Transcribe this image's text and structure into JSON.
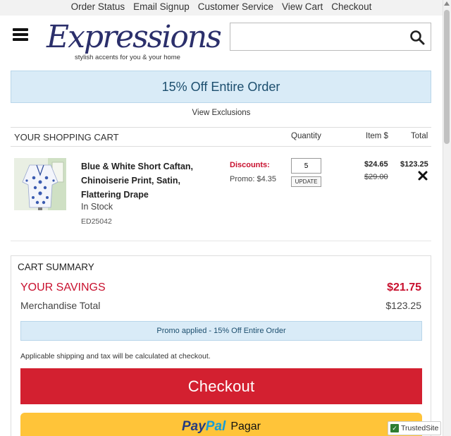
{
  "topnav": {
    "items": [
      "Order Status",
      "Email Signup",
      "Customer Service",
      "View Cart",
      "Checkout"
    ]
  },
  "header": {
    "logo_text": "Expressions",
    "logo_tagline": "stylish accents for you & your home",
    "search_placeholder": ""
  },
  "promo": {
    "banner": "15% Off Entire Order",
    "view_exclusions": "View Exclusions"
  },
  "cart": {
    "title": "YOUR SHOPPING CART",
    "col_quantity": "Quantity",
    "col_item_price": "Item $",
    "col_total": "Total",
    "items": [
      {
        "name": "Blue & White Short Caftan, Chinoiserie Print, Satin, Flattering Drape",
        "stock": "In Stock",
        "sku": "ED25042",
        "discounts_label": "Discounts:",
        "discount_promo": "Promo: $4.35",
        "quantity": "5",
        "update_label": "UPDATE",
        "price": "$24.65",
        "original_price": "$29.00",
        "line_total": "$123.25"
      }
    ]
  },
  "summary": {
    "title": "CART SUMMARY",
    "savings_label": "YOUR SAVINGS",
    "savings_value": "$21.75",
    "merch_label": "Merchandise Total",
    "merch_value": "$123.25",
    "promo_applied": "Promo applied - 15% Off Entire Order",
    "shipping_note": "Applicable shipping and tax will be calculated at checkout.",
    "checkout_label": "Checkout",
    "paypal_pay": "Pay",
    "paypal_pal": "Pal",
    "paypal_pagar": "Pagar"
  },
  "trusted": {
    "label": "TrustedSite"
  },
  "colors": {
    "accent_red": "#d32030",
    "promo_blue": "#d9ebf7",
    "paypal_yellow": "#ffc439",
    "logo_navy": "#2b2f6b"
  }
}
